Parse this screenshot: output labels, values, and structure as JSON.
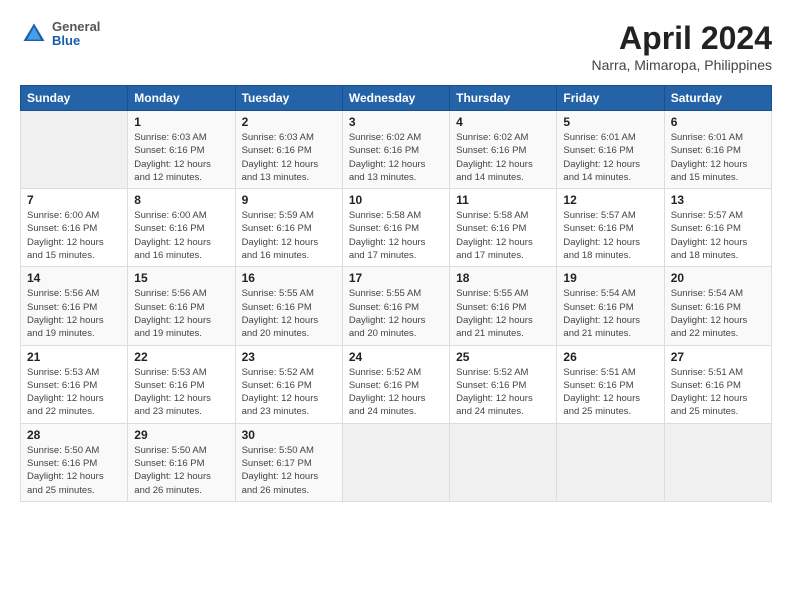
{
  "logo": {
    "general": "General",
    "blue": "Blue"
  },
  "header": {
    "month_year": "April 2024",
    "location": "Narra, Mimaropa, Philippines"
  },
  "days_of_week": [
    "Sunday",
    "Monday",
    "Tuesday",
    "Wednesday",
    "Thursday",
    "Friday",
    "Saturday"
  ],
  "weeks": [
    [
      {
        "day": "",
        "info": ""
      },
      {
        "day": "1",
        "info": "Sunrise: 6:03 AM\nSunset: 6:16 PM\nDaylight: 12 hours\nand 12 minutes."
      },
      {
        "day": "2",
        "info": "Sunrise: 6:03 AM\nSunset: 6:16 PM\nDaylight: 12 hours\nand 13 minutes."
      },
      {
        "day": "3",
        "info": "Sunrise: 6:02 AM\nSunset: 6:16 PM\nDaylight: 12 hours\nand 13 minutes."
      },
      {
        "day": "4",
        "info": "Sunrise: 6:02 AM\nSunset: 6:16 PM\nDaylight: 12 hours\nand 14 minutes."
      },
      {
        "day": "5",
        "info": "Sunrise: 6:01 AM\nSunset: 6:16 PM\nDaylight: 12 hours\nand 14 minutes."
      },
      {
        "day": "6",
        "info": "Sunrise: 6:01 AM\nSunset: 6:16 PM\nDaylight: 12 hours\nand 15 minutes."
      }
    ],
    [
      {
        "day": "7",
        "info": "Sunrise: 6:00 AM\nSunset: 6:16 PM\nDaylight: 12 hours\nand 15 minutes."
      },
      {
        "day": "8",
        "info": "Sunrise: 6:00 AM\nSunset: 6:16 PM\nDaylight: 12 hours\nand 16 minutes."
      },
      {
        "day": "9",
        "info": "Sunrise: 5:59 AM\nSunset: 6:16 PM\nDaylight: 12 hours\nand 16 minutes."
      },
      {
        "day": "10",
        "info": "Sunrise: 5:58 AM\nSunset: 6:16 PM\nDaylight: 12 hours\nand 17 minutes."
      },
      {
        "day": "11",
        "info": "Sunrise: 5:58 AM\nSunset: 6:16 PM\nDaylight: 12 hours\nand 17 minutes."
      },
      {
        "day": "12",
        "info": "Sunrise: 5:57 AM\nSunset: 6:16 PM\nDaylight: 12 hours\nand 18 minutes."
      },
      {
        "day": "13",
        "info": "Sunrise: 5:57 AM\nSunset: 6:16 PM\nDaylight: 12 hours\nand 18 minutes."
      }
    ],
    [
      {
        "day": "14",
        "info": "Sunrise: 5:56 AM\nSunset: 6:16 PM\nDaylight: 12 hours\nand 19 minutes."
      },
      {
        "day": "15",
        "info": "Sunrise: 5:56 AM\nSunset: 6:16 PM\nDaylight: 12 hours\nand 19 minutes."
      },
      {
        "day": "16",
        "info": "Sunrise: 5:55 AM\nSunset: 6:16 PM\nDaylight: 12 hours\nand 20 minutes."
      },
      {
        "day": "17",
        "info": "Sunrise: 5:55 AM\nSunset: 6:16 PM\nDaylight: 12 hours\nand 20 minutes."
      },
      {
        "day": "18",
        "info": "Sunrise: 5:55 AM\nSunset: 6:16 PM\nDaylight: 12 hours\nand 21 minutes."
      },
      {
        "day": "19",
        "info": "Sunrise: 5:54 AM\nSunset: 6:16 PM\nDaylight: 12 hours\nand 21 minutes."
      },
      {
        "day": "20",
        "info": "Sunrise: 5:54 AM\nSunset: 6:16 PM\nDaylight: 12 hours\nand 22 minutes."
      }
    ],
    [
      {
        "day": "21",
        "info": "Sunrise: 5:53 AM\nSunset: 6:16 PM\nDaylight: 12 hours\nand 22 minutes."
      },
      {
        "day": "22",
        "info": "Sunrise: 5:53 AM\nSunset: 6:16 PM\nDaylight: 12 hours\nand 23 minutes."
      },
      {
        "day": "23",
        "info": "Sunrise: 5:52 AM\nSunset: 6:16 PM\nDaylight: 12 hours\nand 23 minutes."
      },
      {
        "day": "24",
        "info": "Sunrise: 5:52 AM\nSunset: 6:16 PM\nDaylight: 12 hours\nand 24 minutes."
      },
      {
        "day": "25",
        "info": "Sunrise: 5:52 AM\nSunset: 6:16 PM\nDaylight: 12 hours\nand 24 minutes."
      },
      {
        "day": "26",
        "info": "Sunrise: 5:51 AM\nSunset: 6:16 PM\nDaylight: 12 hours\nand 25 minutes."
      },
      {
        "day": "27",
        "info": "Sunrise: 5:51 AM\nSunset: 6:16 PM\nDaylight: 12 hours\nand 25 minutes."
      }
    ],
    [
      {
        "day": "28",
        "info": "Sunrise: 5:50 AM\nSunset: 6:16 PM\nDaylight: 12 hours\nand 25 minutes."
      },
      {
        "day": "29",
        "info": "Sunrise: 5:50 AM\nSunset: 6:16 PM\nDaylight: 12 hours\nand 26 minutes."
      },
      {
        "day": "30",
        "info": "Sunrise: 5:50 AM\nSunset: 6:17 PM\nDaylight: 12 hours\nand 26 minutes."
      },
      {
        "day": "",
        "info": ""
      },
      {
        "day": "",
        "info": ""
      },
      {
        "day": "",
        "info": ""
      },
      {
        "day": "",
        "info": ""
      }
    ]
  ]
}
